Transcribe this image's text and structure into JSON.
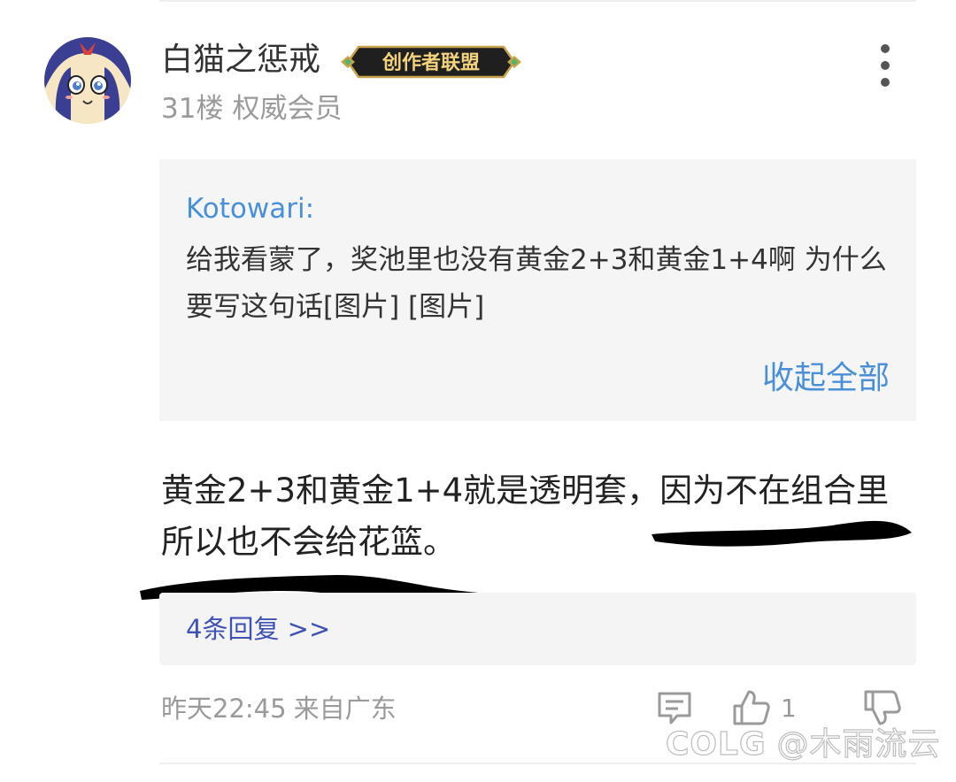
{
  "post": {
    "username": "白猫之惩戒",
    "badge": "创作者联盟",
    "floor": "31楼",
    "member_level": "权威会员",
    "quote": {
      "author": "Kotowari:",
      "text": "给我看蒙了，奖池里也没有黄金2+3和黄金1+4啊 为什么要写这句话[图片] [图片]",
      "collapse_label": "收起全部"
    },
    "content": "黄金2+3和黄金1+4就是透明套，因为不在组合里所以也不会给花篮。",
    "replies_link": "4条回复 >>",
    "time": "昨天22:45",
    "location": "来自广东",
    "like_count": "1"
  },
  "icons": {
    "more": "more-vertical-icon",
    "comment": "comment-icon",
    "like": "thumbs-up-icon",
    "dislike": "thumbs-down-icon"
  },
  "watermark": {
    "brand": "COLG",
    "user": "@木雨流云"
  },
  "colors": {
    "link_blue": "#4a90d9",
    "reply_link": "#3f51b5",
    "quote_bg": "#f5f5f5",
    "gray_text": "#9a9a9a"
  }
}
